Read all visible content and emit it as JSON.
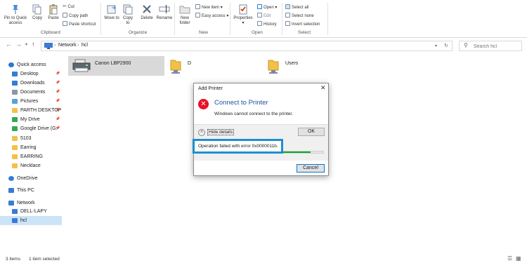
{
  "ribbon": {
    "clipboard": {
      "label": "Clipboard",
      "pin_label": "Pin to Quick access",
      "copy_label": "Copy",
      "paste_label": "Paste",
      "cut_label": "Cut",
      "copy_path_label": "Copy path",
      "paste_shortcut_label": "Paste shortcut"
    },
    "organize": {
      "label": "Organize",
      "move_to_label": "Move to",
      "copy_to_label": "Copy to",
      "delete_label": "Delete",
      "rename_label": "Rename"
    },
    "new": {
      "label": "New",
      "new_folder_label": "New folder",
      "new_item_label": "New item",
      "easy_access_label": "Easy access"
    },
    "open": {
      "label": "Open",
      "properties_label": "Properties",
      "open_label": "Open",
      "edit_label": "Edit",
      "history_label": "History"
    },
    "select": {
      "label": "Select",
      "select_all_label": "Select all",
      "select_none_label": "Select none",
      "invert_selection_label": "Invert selection"
    }
  },
  "address": {
    "crumbs": [
      "Network",
      "hcl"
    ],
    "search_placeholder": "Search hcl"
  },
  "sidebar": {
    "items": [
      {
        "label": "Quick access",
        "icon": "star-icon",
        "pinned": false
      },
      {
        "label": "Desktop",
        "icon": "desktop-icon",
        "pinned": true
      },
      {
        "label": "Downloads",
        "icon": "download-icon",
        "pinned": true
      },
      {
        "label": "Documents",
        "icon": "document-icon",
        "pinned": true
      },
      {
        "label": "Pictures",
        "icon": "picture-icon",
        "pinned": true
      },
      {
        "label": "PARTH DESKTOP",
        "icon": "folder-icon",
        "pinned": true
      },
      {
        "label": "My Drive",
        "icon": "drive-icon",
        "pinned": true
      },
      {
        "label": "Google Drive (G:",
        "icon": "drive-icon",
        "pinned": true
      },
      {
        "label": "5103",
        "icon": "folder-icon",
        "pinned": false
      },
      {
        "label": "Earring",
        "icon": "folder-icon",
        "pinned": false
      },
      {
        "label": "EARRING",
        "icon": "folder-icon",
        "pinned": false
      },
      {
        "label": "Necklace",
        "icon": "folder-icon",
        "pinned": false
      },
      {
        "label": "OneDrive",
        "icon": "cloud-icon",
        "pinned": false
      },
      {
        "label": "This PC",
        "icon": "computer-icon",
        "pinned": false
      },
      {
        "label": "Network",
        "icon": "network-icon",
        "pinned": false
      },
      {
        "label": "DELL-LAPY",
        "icon": "computer-icon",
        "pinned": false
      },
      {
        "label": "hcl",
        "icon": "computer-icon",
        "pinned": false
      }
    ]
  },
  "content": {
    "items": [
      {
        "label": "Canon LBP2900",
        "icon": "printer-icon"
      },
      {
        "label": "D",
        "icon": "shared-folder-icon"
      },
      {
        "label": "Users",
        "icon": "shared-folder-icon"
      }
    ]
  },
  "dialog": {
    "title": "Add Printer",
    "close_glyph": "✕",
    "error_glyph": "✕",
    "heading": "Connect to Printer",
    "message": "Windows cannot connect to the printer.",
    "hide_details_label": "Hide details",
    "ok_label": "OK",
    "error_detail": "Operation failed with error 0x0000011b.",
    "progress_fraction": 0.9,
    "cancel_label": "Cancel"
  },
  "status": {
    "item_count": "3 items",
    "selected": "1 item selected"
  },
  "colors": {
    "accent": "#0078d7",
    "highlight": "#1e8fcf",
    "error": "#e81123",
    "folder": "#f3c14a",
    "progress": "#06b025"
  }
}
